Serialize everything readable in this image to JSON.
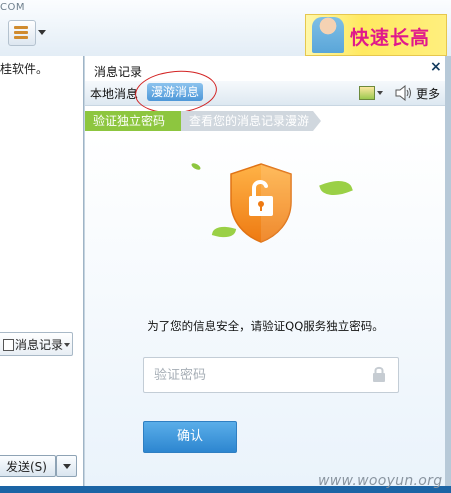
{
  "top": {
    "com_text": "COM",
    "ad_text": "快速长高"
  },
  "left_pane": {
    "chat_text": "桂软件。",
    "history_label": "消息记录",
    "send_label": "发送(S)"
  },
  "panel": {
    "title": "消息记录",
    "close": "×",
    "tabs": {
      "local": "本地消息",
      "roam": "漫游消息"
    },
    "more_label": "更多",
    "steps": {
      "step1": "验证独立密码",
      "step2": "查看您的消息记录漫游"
    },
    "prompt": "为了您的信息安全，请验证QQ服务独立密码。",
    "password_placeholder": "验证密码",
    "confirm_label": "确认"
  },
  "watermark": "www.wooyun.org",
  "colors": {
    "accent_blue": "#2d86d0",
    "step_active": "#8dc63f",
    "shield_orange": "#f08a1c",
    "highlight_circle": "#d32424"
  },
  "icons": [
    "menu-icon",
    "image-icon",
    "speaker-icon",
    "shield-unlock-icon",
    "lock-icon",
    "close-icon"
  ]
}
